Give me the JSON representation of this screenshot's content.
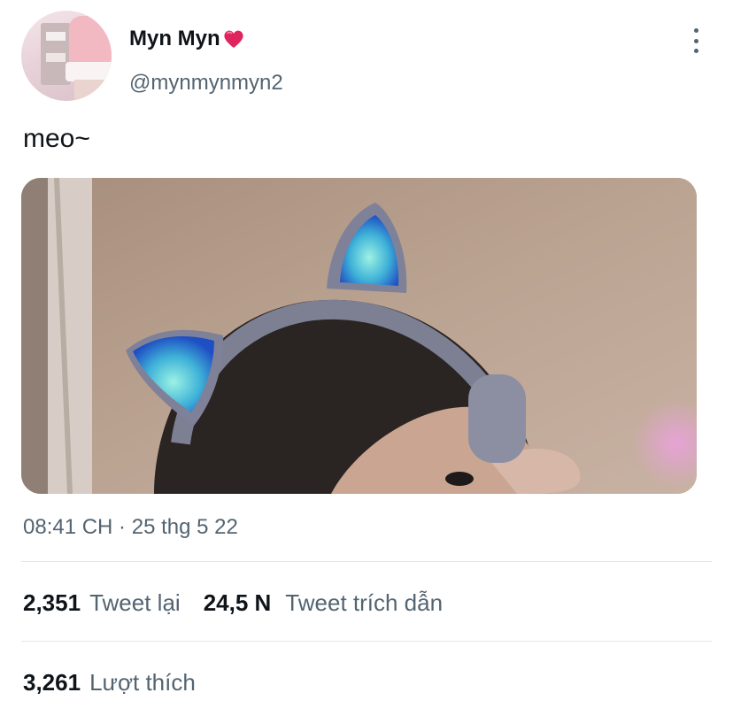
{
  "author": {
    "display_name": "Myn Myn",
    "emoji": "heart-icon",
    "handle": "@mynmynmyn2"
  },
  "tweet": {
    "text": "meo~",
    "timestamp": "08:41 CH · 25 thg 5 22"
  },
  "stats": {
    "retweets_count": "2,351",
    "retweets_label": "Tweet lại",
    "quotes_count": "24,5 N",
    "quotes_label": "Tweet trích dẫn",
    "likes_count": "3,261",
    "likes_label": "Lượt thích"
  },
  "colors": {
    "text_primary": "#0f1419",
    "text_secondary": "#536471",
    "divider": "#e1e6ea",
    "heart": "#e0245e"
  }
}
